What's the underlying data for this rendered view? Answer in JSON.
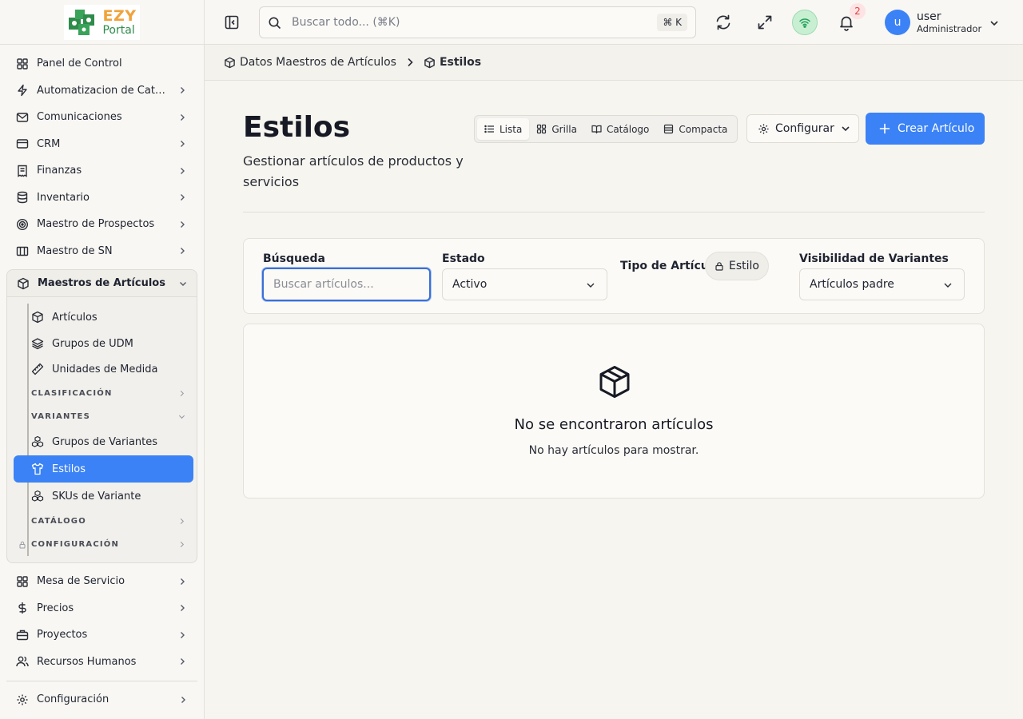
{
  "brand": {
    "logo_top": "EZY",
    "logo_bottom": "Portal"
  },
  "sidebar": {
    "items_top": [
      {
        "label": "Panel de Control",
        "icon": "grid-icon",
        "chevron": false
      },
      {
        "label": "Automatizacion de Catalogo",
        "icon": "bolt-icon",
        "chevron": true
      },
      {
        "label": "Comunicaciones",
        "icon": "mail-icon",
        "chevron": true
      },
      {
        "label": "CRM",
        "icon": "card-icon",
        "chevron": true
      },
      {
        "label": "Finanzas",
        "icon": "receipt-icon",
        "chevron": true
      },
      {
        "label": "Inventario",
        "icon": "database-icon",
        "chevron": true
      },
      {
        "label": "Maestro de Prospectos",
        "icon": "target-icon",
        "chevron": true
      },
      {
        "label": "Maestro de SN",
        "icon": "building-icon",
        "chevron": true
      }
    ],
    "group": {
      "label": "Maestros de Artículos",
      "items": [
        {
          "type": "item",
          "label": "Artículos",
          "icon": "box-icon"
        },
        {
          "type": "item",
          "label": "Grupos de UDM",
          "icon": "layers-icon"
        },
        {
          "type": "item",
          "label": "Unidades de Medida",
          "icon": "ruler-icon"
        },
        {
          "type": "section",
          "label": "CLASIFICACIÓN",
          "state": "collapsed"
        },
        {
          "type": "section",
          "label": "VARIANTES",
          "state": "expanded"
        },
        {
          "type": "item",
          "label": "Grupos de Variantes",
          "icon": "boxes-icon"
        },
        {
          "type": "item",
          "label": "Estilos",
          "icon": "shirt-icon",
          "active": true
        },
        {
          "type": "item",
          "label": "SKUs de Variante",
          "icon": "boxes-icon"
        },
        {
          "type": "section",
          "label": "CATÁLOGO",
          "state": "collapsed"
        },
        {
          "type": "section",
          "label": "CONFIGURACIÓN",
          "state": "collapsed",
          "locked": true
        }
      ]
    },
    "items_bottom": [
      {
        "label": "Mesa de Servicio",
        "icon": "grid-icon",
        "chevron": true
      },
      {
        "label": "Precios",
        "icon": "dollar-icon",
        "chevron": true
      },
      {
        "label": "Proyectos",
        "icon": "briefcase-icon",
        "chevron": true
      },
      {
        "label": "Recursos Humanos",
        "icon": "users-icon",
        "chevron": true
      }
    ],
    "footer_item": {
      "label": "Configuración",
      "icon": "gear-icon"
    }
  },
  "topbar": {
    "search_placeholder": "Buscar todo... (⌘K)",
    "shortcut": "⌘ K",
    "notifications_count": "2",
    "user_initial": "u",
    "user_name": "user",
    "user_role": "Administrador",
    "colors": {
      "accent": "#3b82f6",
      "online": "#22a35a"
    }
  },
  "breadcrumb": [
    {
      "label": "Datos Maestros de Artículos"
    },
    {
      "label": "Estilos"
    }
  ],
  "page": {
    "title": "Estilos",
    "subtitle": "Gestionar artículos de productos y servicios",
    "views": [
      {
        "label": "Lista",
        "icon": "list-icon",
        "active": true
      },
      {
        "label": "Grilla",
        "icon": "grid-icon"
      },
      {
        "label": "Catálogo",
        "icon": "book-icon"
      },
      {
        "label": "Compacta",
        "icon": "compact-icon"
      }
    ],
    "configure_label": "Configurar",
    "create_label": "Crear Artículo"
  },
  "filters": {
    "search_label": "Búsqueda",
    "search_placeholder": "Buscar artículos...",
    "status_label": "Estado",
    "status_value": "Activo",
    "type_label": "Tipo de Artículo",
    "type_value": "Estilo",
    "variants_label": "Visibilidad de Variantes",
    "variants_value": "Artículos padre"
  },
  "empty_state": {
    "title": "No se encontraron artículos",
    "message": "No hay artículos para mostrar."
  }
}
